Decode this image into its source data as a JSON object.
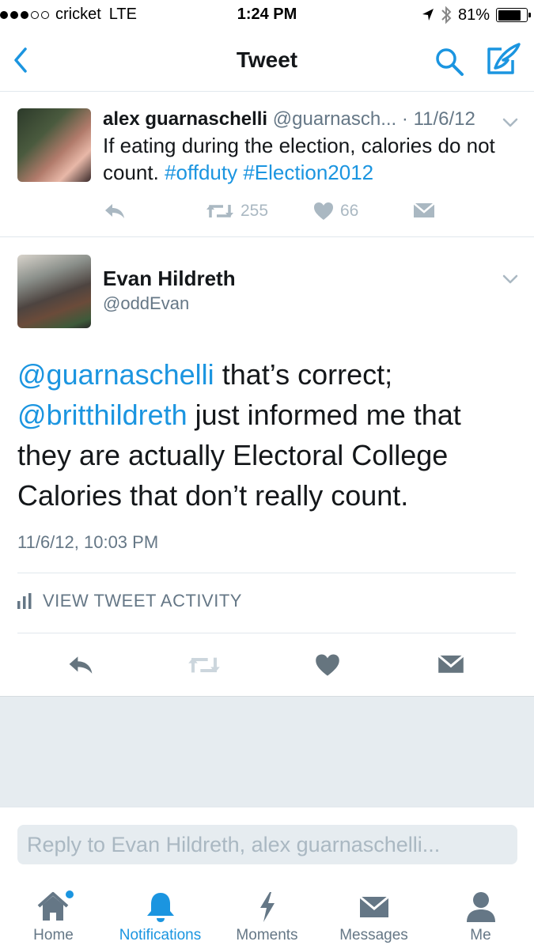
{
  "status_bar": {
    "carrier": "cricket",
    "network": "LTE",
    "time": "1:24 PM",
    "battery": "81%",
    "battery_level": 0.81
  },
  "nav": {
    "title": "Tweet",
    "back_icon": "back-chevron-icon",
    "search_icon": "search-icon",
    "compose_icon": "compose-icon"
  },
  "parent_tweet": {
    "name": "alex guarnaschelli",
    "handle": "@guarnasch...",
    "date": "· 11/6/12",
    "text_before": "If eating during the election, calories do not count. ",
    "hashtag1": "#offduty",
    "hashtag2": "#Election2012",
    "retweets": "255",
    "likes": "66"
  },
  "main_tweet": {
    "name": "Evan Hildreth",
    "handle": "@oddEvan",
    "mention1": "@guarnaschelli",
    "text1": " that’s correct; ",
    "mention2": "@britthildreth",
    "text2": " just informed me that they  are actually Electoral College Calories that don’t really count.",
    "timestamp": "11/6/12, 10:03 PM",
    "activity_label": "VIEW TWEET ACTIVITY"
  },
  "reply": {
    "placeholder": "Reply to Evan Hildreth, alex guarnaschelli..."
  },
  "tabs": [
    {
      "label": "Home",
      "icon": "home-icon"
    },
    {
      "label": "Notifications",
      "icon": "bell-icon"
    },
    {
      "label": "Moments",
      "icon": "lightning-icon"
    },
    {
      "label": "Messages",
      "icon": "envelope-icon"
    },
    {
      "label": "Me",
      "icon": "person-icon"
    }
  ],
  "colors": {
    "accent": "#1b95e0",
    "secondary_text": "#657786",
    "icon_gray": "#aab8c2",
    "action_gray": "#66757f",
    "background_gray": "#e6ecf0"
  }
}
